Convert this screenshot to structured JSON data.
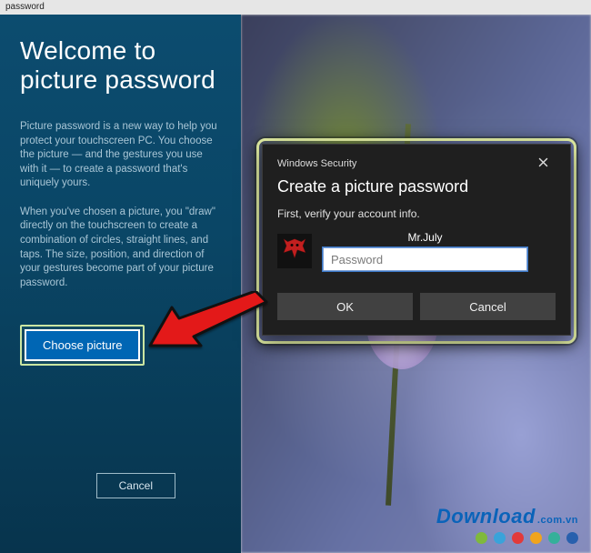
{
  "topbar": {
    "label": "password"
  },
  "left": {
    "title": "Welcome to picture password",
    "para1": "Picture password is a new way to help you protect your touchscreen PC. You choose the picture — and the gestures you use with it — to create a password that's uniquely yours.",
    "para2": "When you've chosen a picture, you \"draw\" directly on the touchscreen to create a combination of circles, straight lines, and taps. The size, position, and direction of your gestures become part of your picture password.",
    "choose_label": "Choose picture",
    "cancel_label": "Cancel"
  },
  "dialog": {
    "header": "Windows Security",
    "title": "Create a picture password",
    "subtitle": "First, verify your account info.",
    "username": "Mr.July",
    "password_placeholder": "Password",
    "ok_label": "OK",
    "cancel_label": "Cancel"
  },
  "watermark": {
    "brand": "Download",
    "ext": ".com.vn",
    "dot_colors": [
      "#7fb93c",
      "#39a3da",
      "#e23a3a",
      "#f0a41e",
      "#35b09a",
      "#2860ad"
    ]
  }
}
